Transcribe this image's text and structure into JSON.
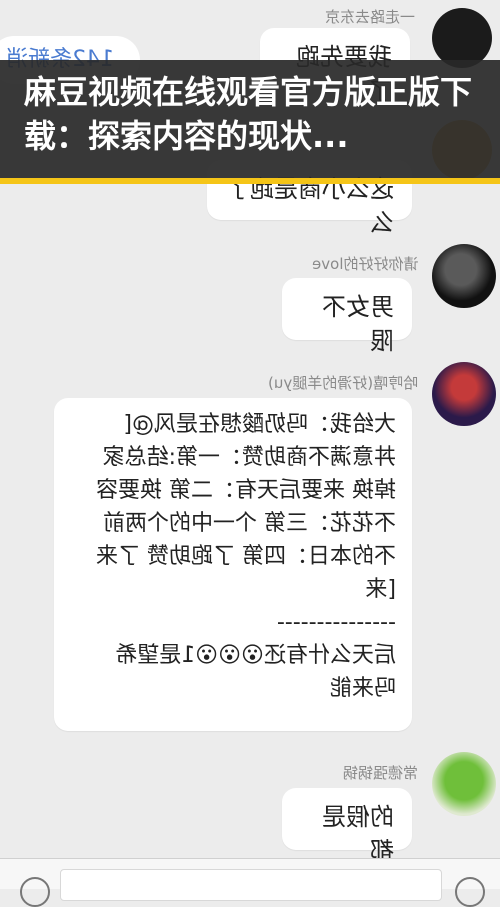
{
  "header": {
    "group_name": "一走路去东京",
    "unread_badge": "142条新消"
  },
  "banner": {
    "title": "麻豆视频在线观看官方版正版下载：探索内容的现状..."
  },
  "messages": [
    {
      "sender": "",
      "text": "我要先跑了"
    },
    {
      "sender": "",
      "text": "这么小商是跑了么"
    },
    {
      "sender": "请你好好的love",
      "text": "男女不限"
    },
    {
      "sender": "哈哼嘻(好滑的羊腿yu)",
      "text": "大给我：吗奶酸想在是风@[\n丼意满不商助赞：一第:结总家\n掉换 来要后天有：二第 换要容\n不花花：三第 个一中的个两前\n不的本日：四第 了跑助赞 了来\n[来\n---------------\n后天么什有还😮😮😮1是望希\n吗来能"
    },
    {
      "sender": "常德强锅锅",
      "text": "的假是都"
    }
  ],
  "input": {
    "placeholder": ""
  },
  "colors": {
    "banner_bg": "#282828",
    "banner_accent": "#f5c518",
    "chat_bg": "#ececec",
    "link_blue": "#4a7bd0"
  }
}
